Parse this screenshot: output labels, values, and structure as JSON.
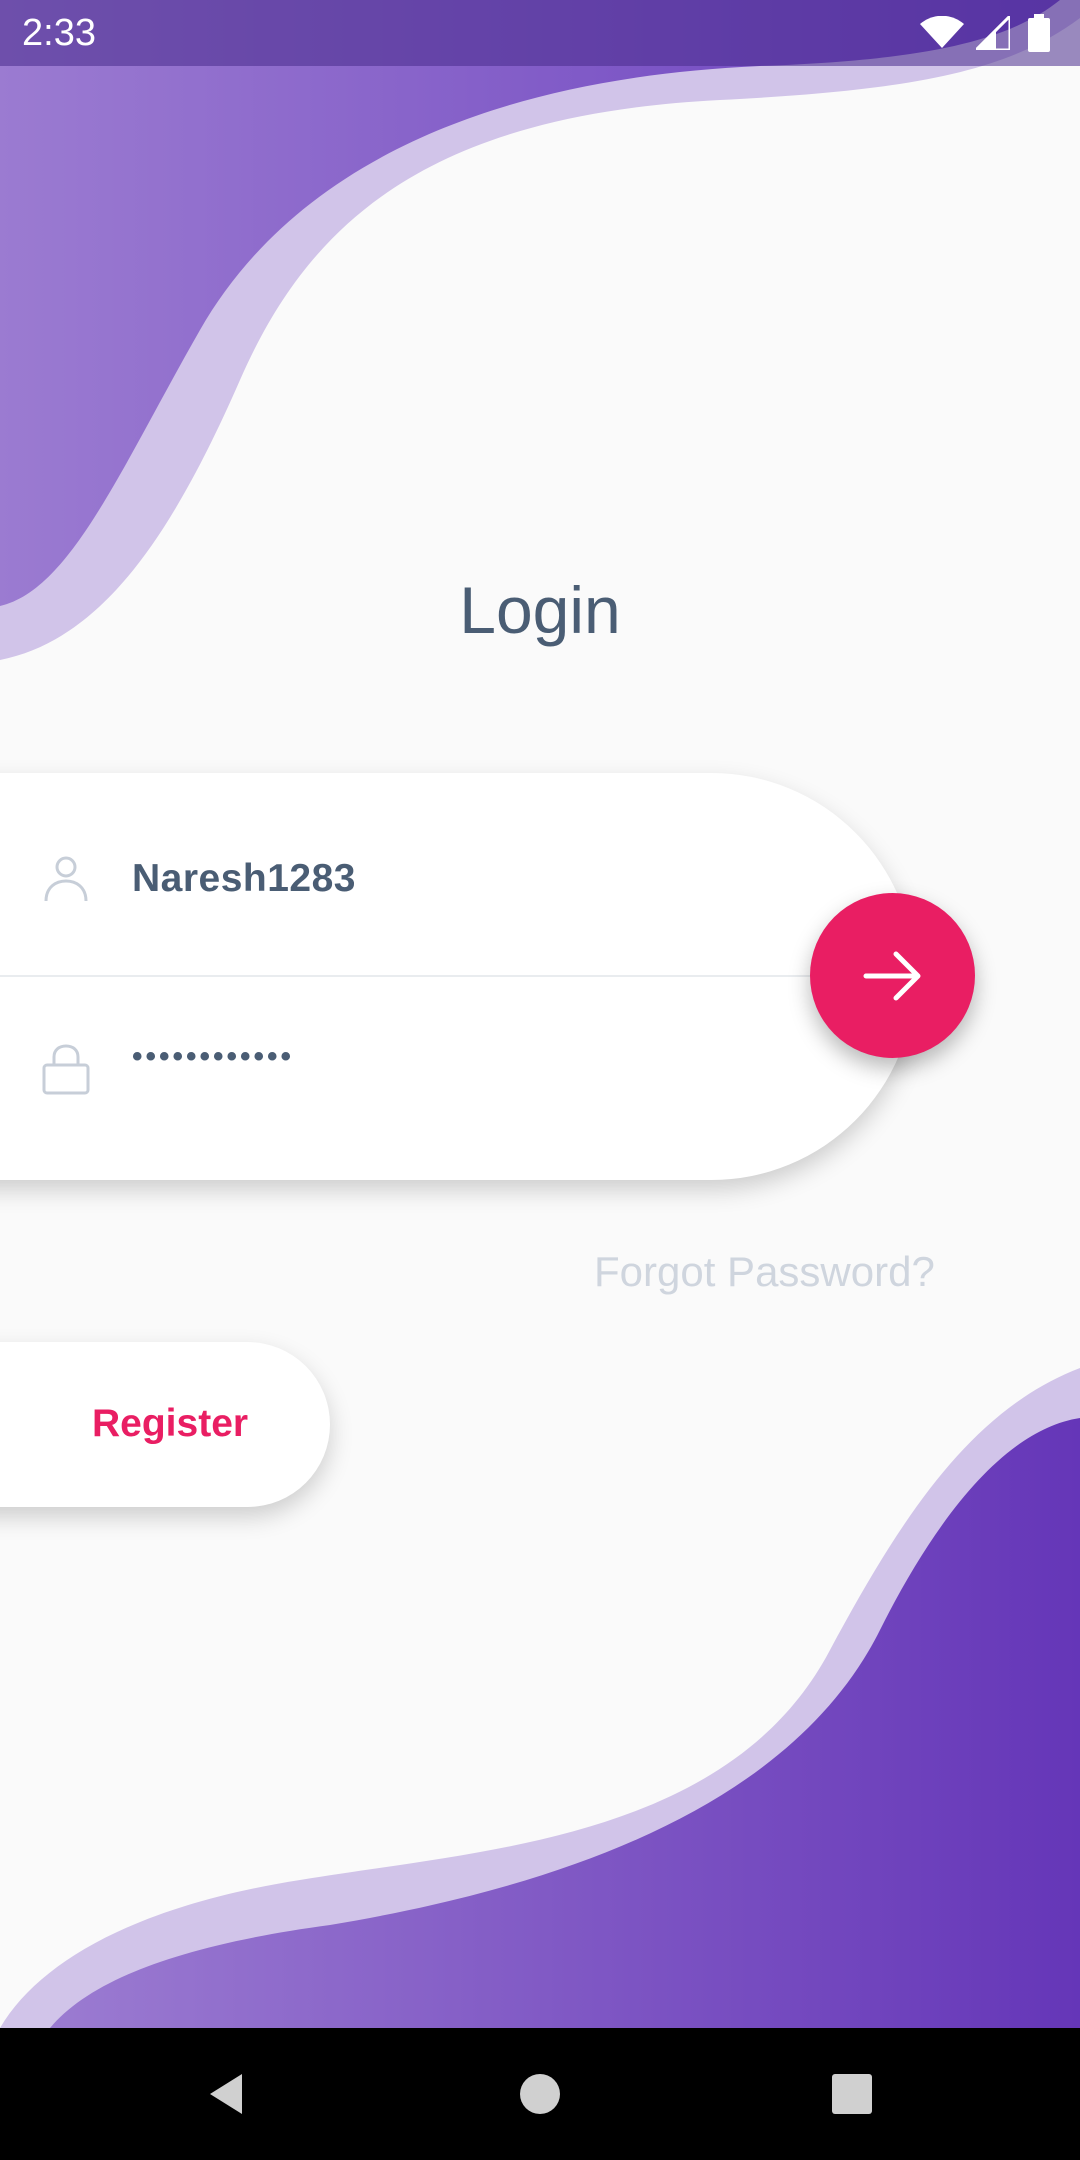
{
  "status_bar": {
    "time": "2:33",
    "icons": [
      "wifi-icon",
      "cell-signal-icon",
      "battery-icon"
    ]
  },
  "login": {
    "title": "Login",
    "username_value": "Naresh1283",
    "password_value": "••••••••••••",
    "submit_icon": "arrow-right-icon",
    "forgot_label": "Forgot Password?",
    "register_label": "Register"
  },
  "nav_bar": {
    "icons": [
      "back-icon",
      "home-icon",
      "recents-icon"
    ]
  },
  "colors": {
    "accent": "#e91e63",
    "wave_dark": "#6a3fbf",
    "wave_light": "#d1c4e9",
    "text_primary": "#4a5d74",
    "text_muted": "#cfd5de",
    "background": "#fafafa"
  }
}
